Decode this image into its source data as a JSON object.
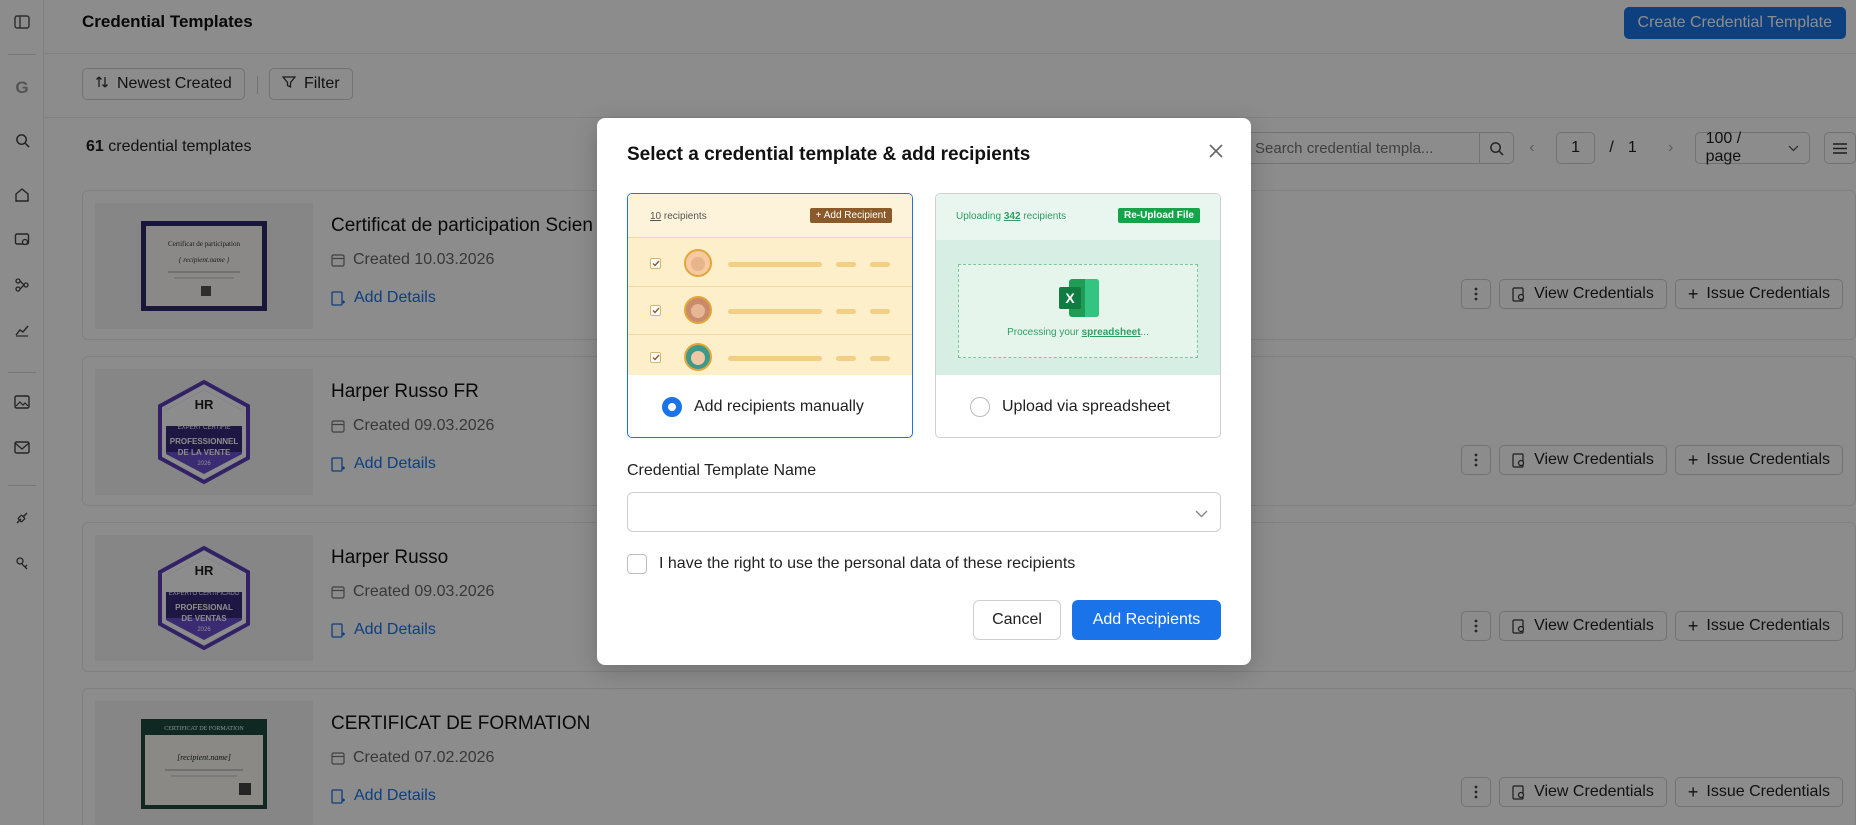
{
  "topbar": {
    "title": "Credential Templates",
    "create_button": "Create Credential Template"
  },
  "toolbar": {
    "sort_label": "Newest Created",
    "filter_label": "Filter"
  },
  "listbar": {
    "count_number": "61",
    "count_suffix": "credential templates",
    "search_placeholder": "Search credential templa...",
    "page_current": "1",
    "page_separator": "/",
    "page_total": "1",
    "page_size": "100 / page"
  },
  "sidebar": {
    "logo_letter": "G"
  },
  "cards": [
    {
      "title": "Certificat de participation Scien",
      "date": "Created 10.03.2026",
      "add_details": "Add Details",
      "thumb": {
        "heading": "Certificat de participation",
        "name": "{ recipient.name }"
      }
    },
    {
      "title": "Harper Russo FR",
      "date": "Created 09.03.2026",
      "add_details": "Add Details",
      "thumb": {
        "logo": "HR",
        "top": "EXPERT CERTIFIÉ",
        "main1": "PROFESSIONNEL",
        "main2": "DE LA VENTE",
        "year": "2026"
      }
    },
    {
      "title": "Harper Russo",
      "date": "Created 09.03.2026",
      "add_details": "Add Details",
      "thumb": {
        "logo": "HR",
        "top": "EXPERTO CERTIFICADO",
        "main1": "PROFESIONAL",
        "main2": "DE VENTAS",
        "year": "2026"
      }
    },
    {
      "title": "CERTIFICAT DE FORMATION",
      "date": "Created 07.02.2026",
      "add_details": "Add Details",
      "thumb": {
        "heading": "CERTIFICAT DE FORMATION",
        "name": "[recipient.name]"
      }
    }
  ],
  "card_actions": {
    "view": "View Credentials",
    "issue": "Issue Credentials"
  },
  "modal": {
    "title": "Select a credential template & add recipients",
    "option_manual": {
      "label": "Add recipients manually",
      "recipients_count": "10",
      "recipients_word": "recipients",
      "add_button": "+ Add Recipient"
    },
    "option_upload": {
      "label": "Upload via spreadsheet",
      "uploading_prefix": "Uploading",
      "uploading_count": "342",
      "uploading_suffix": "recipients",
      "reupload_button": "Re-Upload File",
      "processing_prefix": "Processing your",
      "processing_link": "spreadsheet",
      "processing_suffix": "..."
    },
    "field_label": "Credential Template Name",
    "select_value": "",
    "consent_label": "I have the right to use the personal data of these recipients",
    "cancel": "Cancel",
    "submit": "Add Recipients"
  },
  "colors": {
    "primary": "#1a73e8",
    "badge_purple": "#5b3fb8",
    "upload_green": "#16a34a",
    "manual_bg": "#fdefc9"
  }
}
